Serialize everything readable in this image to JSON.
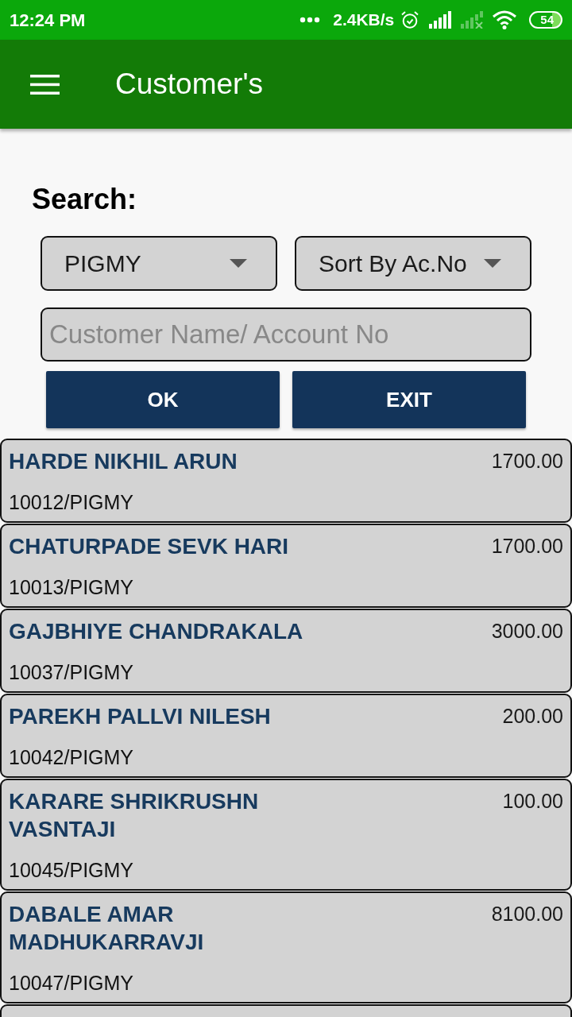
{
  "status_bar": {
    "time": "12:24 PM",
    "network_speed": "2.4KB/s",
    "battery": "54"
  },
  "app_bar": {
    "title": "Customer's"
  },
  "search": {
    "label": "Search:",
    "account_type": {
      "value": "PIGMY"
    },
    "sort": {
      "value": "Sort By Ac.No"
    },
    "query": {
      "placeholder": "Customer Name/ Account No"
    },
    "buttons": [
      "OK",
      "EXIT"
    ]
  },
  "customers": [
    {
      "name": "HARDE NIKHIL ARUN",
      "amount": "1700.00",
      "account": "10012/PIGMY"
    },
    {
      "name": "CHATURPADE SEVK HARI",
      "amount": "1700.00",
      "account": "10013/PIGMY"
    },
    {
      "name": "GAJBHIYE CHANDRAKALA",
      "amount": "3000.00",
      "account": "10037/PIGMY"
    },
    {
      "name": "PAREKH PALLVI NILESH",
      "amount": "200.00",
      "account": "10042/PIGMY"
    },
    {
      "name": "KARARE SHRIKRUSHN VASNTAJI",
      "amount": "100.00",
      "account": "10045/PIGMY"
    },
    {
      "name": "DABALE AMAR MADHUKARRAVJI",
      "amount": "8100.00",
      "account": "10047/PIGMY"
    }
  ]
}
